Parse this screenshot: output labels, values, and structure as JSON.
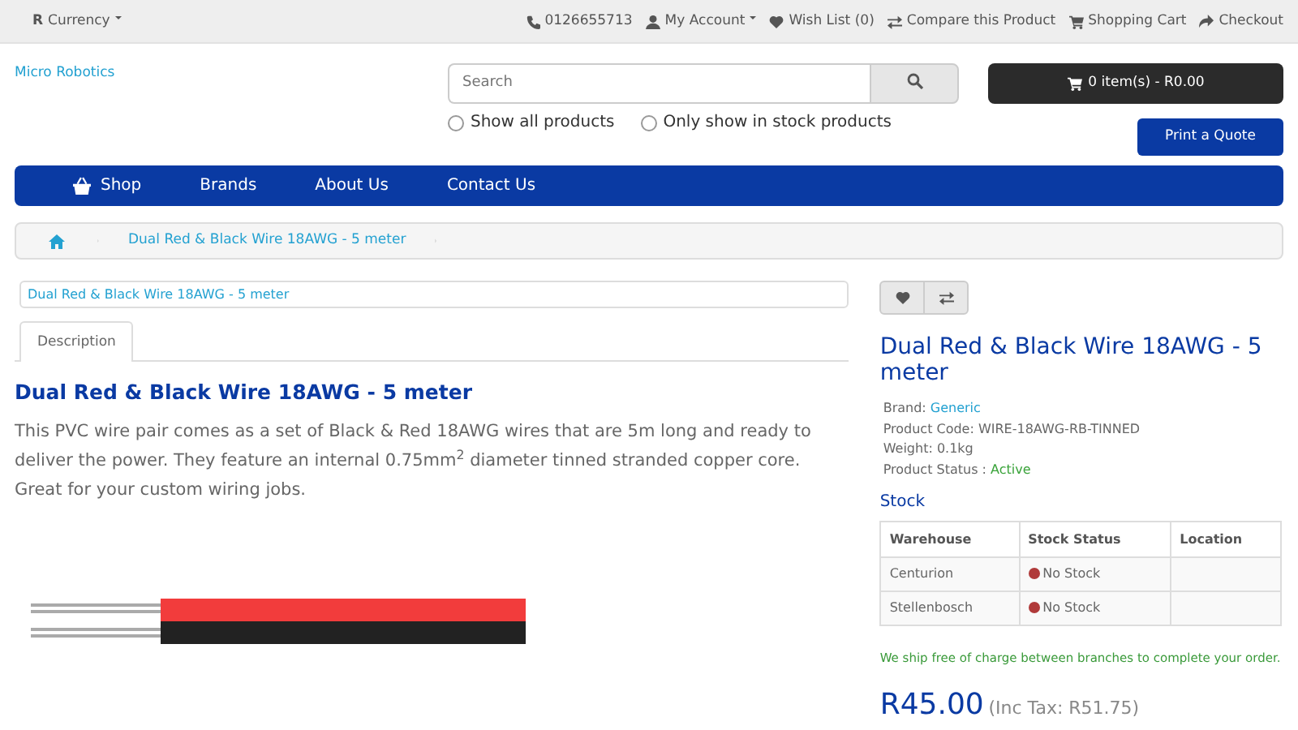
{
  "top_bar": {
    "currency": {
      "symbol": "R",
      "label": "Currency"
    },
    "links": [
      {
        "kind": "phone",
        "label": "0126655713",
        "dropdown": false
      },
      {
        "kind": "account",
        "label": "My Account",
        "dropdown": true
      },
      {
        "kind": "wishlist",
        "label": "Wish List (0)",
        "dropdown": false
      },
      {
        "kind": "compare",
        "label": "Compare this Product",
        "dropdown": false
      },
      {
        "kind": "cart",
        "label": "Shopping Cart",
        "dropdown": false
      },
      {
        "kind": "checkout",
        "label": "Checkout",
        "dropdown": false
      }
    ]
  },
  "logo": "Micro Robotics",
  "search": {
    "placeholder": "Search",
    "filters": [
      {
        "label": "Show all products",
        "selected": false
      },
      {
        "label": "Only show in stock products",
        "selected": false
      }
    ]
  },
  "cart_button": "0 item(s) - R0.00",
  "quote_button": "Print a Quote",
  "menu": [
    {
      "label": "Shop",
      "icon": true
    },
    {
      "label": "Brands",
      "icon": false
    },
    {
      "label": "About Us",
      "icon": false
    },
    {
      "label": "Contact Us",
      "icon": false
    }
  ],
  "breadcrumb": [
    "Dual Red & Black Wire 18AWG - 5 meter"
  ],
  "product_link": "Dual Red & Black Wire 18AWG - 5 meter",
  "tabs": [
    {
      "label": "Description",
      "selected": true
    }
  ],
  "description": {
    "title": "Dual Red & Black Wire 18AWG - 5 meter",
    "text": "This PVC wire pair comes as a set of Black & Red 18AWG wires that are 5m long and ready to deliver the power. They feature an internal 0.75mm$^{2}$ diameter tinned stranded copper core. Great for your custom wiring jobs."
  },
  "product": {
    "title": "Dual Red & Black Wire 18AWG - 5 meter",
    "details": [
      {
        "label": "Brand:",
        "value": "Generic",
        "kind": "link"
      },
      {
        "label": "Product Code:",
        "value": "WIRE-18AWG-RB-TINNED",
        "kind": "plain"
      },
      {
        "label": "Weight:",
        "value": "0.1kg",
        "kind": "plain"
      },
      {
        "label": "Product Status :",
        "value": "Active",
        "kind": "status"
      }
    ],
    "stock_heading": "Stock",
    "stock_columns": [
      "Warehouse",
      "Stock Status",
      "Location"
    ],
    "stock_rows": [
      {
        "warehouse": "Centurion",
        "status": "No Stock",
        "color": "#b03a3a"
      },
      {
        "warehouse": "Stellenbosch",
        "status": "No Stock",
        "color": "#b03a3a"
      }
    ],
    "shipping_note": "We ship free of charge between branches to complete your order.",
    "price": "R45.00",
    "price_tax": "(Inc Tax: R51.75)"
  }
}
